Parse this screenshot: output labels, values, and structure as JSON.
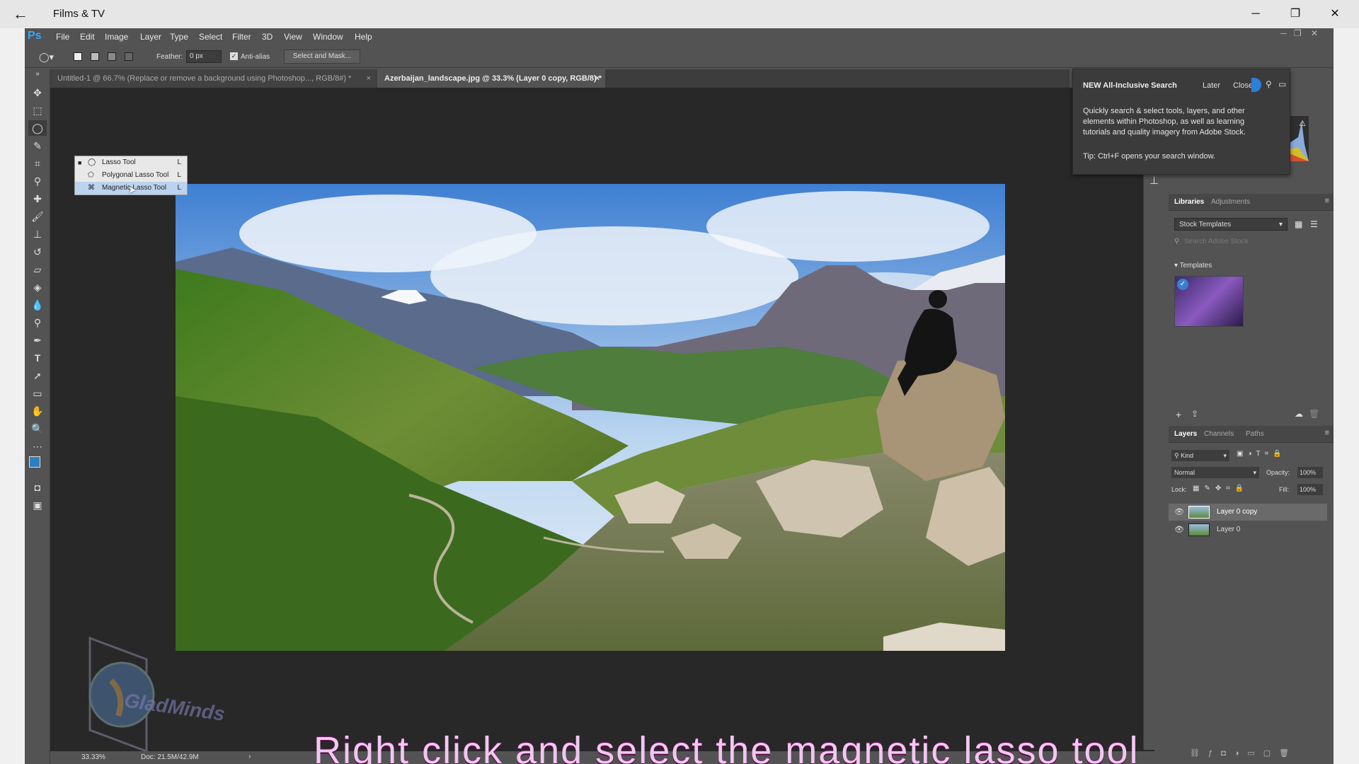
{
  "player": {
    "back_icon": "back-arrow-icon",
    "title": "Films & TV"
  },
  "ps": {
    "logo": "Ps",
    "menus": [
      "File",
      "Edit",
      "Image",
      "Layer",
      "Type",
      "Select",
      "Filter",
      "3D",
      "View",
      "Window",
      "Help"
    ],
    "options": {
      "feather_label": "Feather:",
      "feather_value": "0 px",
      "antialias_label": "Anti-alias",
      "select_mask_label": "Select and Mask..."
    },
    "tabs": [
      {
        "label": "Untitled-1 @ 66.7% (Replace or remove a  background using Photoshop..., RGB/8#) *",
        "active": false
      },
      {
        "label": "Azerbaijan_landscape.jpg @ 33.3% (Layer 0 copy, RGB/8) *",
        "active": true
      }
    ],
    "flyout": [
      {
        "label": "Lasso Tool",
        "shortcut": "L"
      },
      {
        "label": "Polygonal Lasso Tool",
        "shortcut": "L"
      },
      {
        "label": "Magnetic Lasso Tool",
        "shortcut": "L"
      }
    ],
    "status": {
      "zoom": "33.33%",
      "doc": "Doc: 21.5M/42.9M"
    }
  },
  "search_popup": {
    "title": "NEW All-Inclusive Search",
    "later": "Later",
    "close": "Close",
    "body": "Quickly search & select tools, layers, and other elements within Photoshop, as well as learning tutorials and quality imagery from Adobe Stock.",
    "tip": "Tip: Ctrl+F opens your search window."
  },
  "libraries": {
    "tabs": [
      "Libraries",
      "Adjustments"
    ],
    "dropdown": "Stock Templates",
    "search_placeholder": "Search Adobe Stock",
    "section": "Templates"
  },
  "layers": {
    "tabs": [
      "Layers",
      "Channels",
      "Paths"
    ],
    "kind": "Kind",
    "blend": "Normal",
    "opacity_label": "Opacity:",
    "opacity": "100%",
    "lock_label": "Lock:",
    "fill_label": "Fill:",
    "fill": "100%",
    "items": [
      "Layer 0 copy",
      "Layer 0"
    ]
  },
  "watermark_text": "GladMinds",
  "caption": "Right click and select the magnetic lasso tool"
}
